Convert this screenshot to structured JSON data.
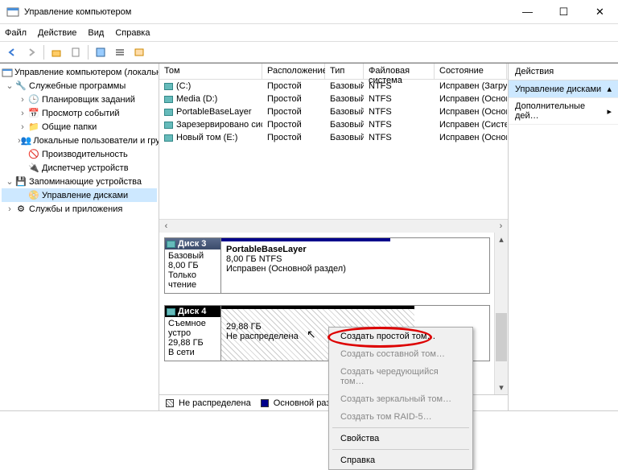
{
  "window": {
    "title": "Управление компьютером"
  },
  "menu": [
    "Файл",
    "Действие",
    "Вид",
    "Справка"
  ],
  "tree": {
    "root": "Управление компьютером (локальным)",
    "g1": "Служебные программы",
    "g1c": [
      "Планировщик заданий",
      "Просмотр событий",
      "Общие папки",
      "Локальные пользователи и группы",
      "Производительность",
      "Диспетчер устройств"
    ],
    "g2": "Запоминающие устройства",
    "g2c": [
      "Управление дисками"
    ],
    "g3": "Службы и приложения"
  },
  "grid": {
    "headers": [
      "Том",
      "Расположение",
      "Тип",
      "Файловая система",
      "Состояние"
    ],
    "rows": [
      [
        "(C:)",
        "Простой",
        "Базовый",
        "NTFS",
        "Исправен (Загрузка, Ф"
      ],
      [
        "Media (D:)",
        "Простой",
        "Базовый",
        "NTFS",
        "Исправен (Основной р"
      ],
      [
        "PortableBaseLayer",
        "Простой",
        "Базовый",
        "NTFS",
        "Исправен (Основной р"
      ],
      [
        "Зарезервировано системой",
        "Простой",
        "Базовый",
        "NTFS",
        "Исправен (Система, А"
      ],
      [
        "Новый том (E:)",
        "Простой",
        "Базовый",
        "NTFS",
        "Исправен (Основной р"
      ]
    ]
  },
  "disks": {
    "d3": {
      "name": "Диск 3",
      "type": "Базовый",
      "size": "8,00 ГБ",
      "status": "Только чтение",
      "part": {
        "name": "PortableBaseLayer",
        "size": "8,00 ГБ NTFS",
        "status": "Исправен (Основной раздел)"
      }
    },
    "d4": {
      "name": "Диск 4",
      "type": "Съемное устро",
      "size": "29,88 ГБ",
      "status": "В сети",
      "part": {
        "size": "29,88 ГБ",
        "status": "Не распределена"
      }
    }
  },
  "legend": {
    "a": "Не распределена",
    "b": "Основной раздел"
  },
  "actions": {
    "title": "Действия",
    "row1": "Управление дисками",
    "row2": "Дополнительные дей…"
  },
  "context": {
    "i0": "Создать простой том…",
    "i1": "Создать составной том…",
    "i2": "Создать чередующийся том…",
    "i3": "Создать зеркальный том…",
    "i4": "Создать том RAID-5…",
    "i5": "Свойства",
    "i6": "Справка"
  }
}
